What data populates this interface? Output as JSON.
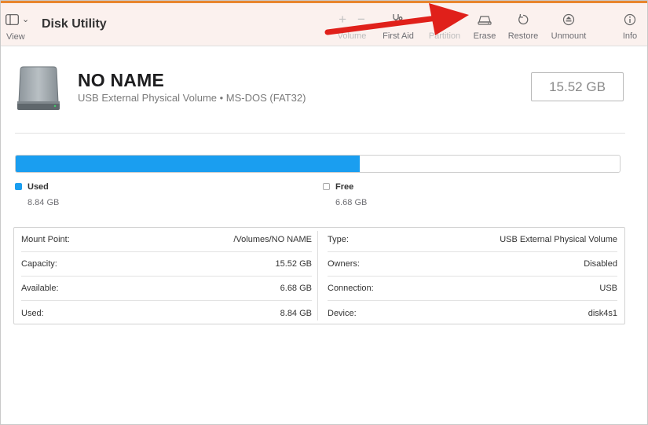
{
  "app": {
    "title": "Disk Utility"
  },
  "toolbar": {
    "view_label": "View",
    "add_symbol": "+",
    "remove_symbol": "−",
    "volume_label": "Volume",
    "first_aid_label": "First Aid",
    "partition_label": "Partition",
    "erase_label": "Erase",
    "restore_label": "Restore",
    "unmount_label": "Unmount",
    "info_label": "Info"
  },
  "volume": {
    "name": "NO NAME",
    "subtitle": "USB External Physical Volume • MS-DOS (FAT32)",
    "capacity": "15.52 GB"
  },
  "usage": {
    "used_fraction": 0.57,
    "used_label": "Used",
    "used_value": "8.84 GB",
    "free_label": "Free",
    "free_value": "6.68 GB"
  },
  "info": {
    "left": [
      {
        "key": "Mount Point:",
        "value": "/Volumes/NO NAME"
      },
      {
        "key": "Capacity:",
        "value": "15.52 GB"
      },
      {
        "key": "Available:",
        "value": "6.68 GB"
      },
      {
        "key": "Used:",
        "value": "8.84 GB"
      }
    ],
    "right": [
      {
        "key": "Type:",
        "value": "USB External Physical Volume"
      },
      {
        "key": "Owners:",
        "value": "Disabled"
      },
      {
        "key": "Connection:",
        "value": "USB"
      },
      {
        "key": "Device:",
        "value": "disk4s1"
      }
    ]
  },
  "colors": {
    "used": "#1a9ef0",
    "annotation_arrow": "#e0201a",
    "accent": "#e8862e"
  },
  "icons": {
    "view": "sidebar-icon",
    "first_aid": "stethoscope-icon",
    "erase": "erase-drive-icon",
    "restore": "restore-arrow-icon",
    "unmount": "eject-icon",
    "info": "info-icon",
    "drive": "external-drive-icon"
  }
}
